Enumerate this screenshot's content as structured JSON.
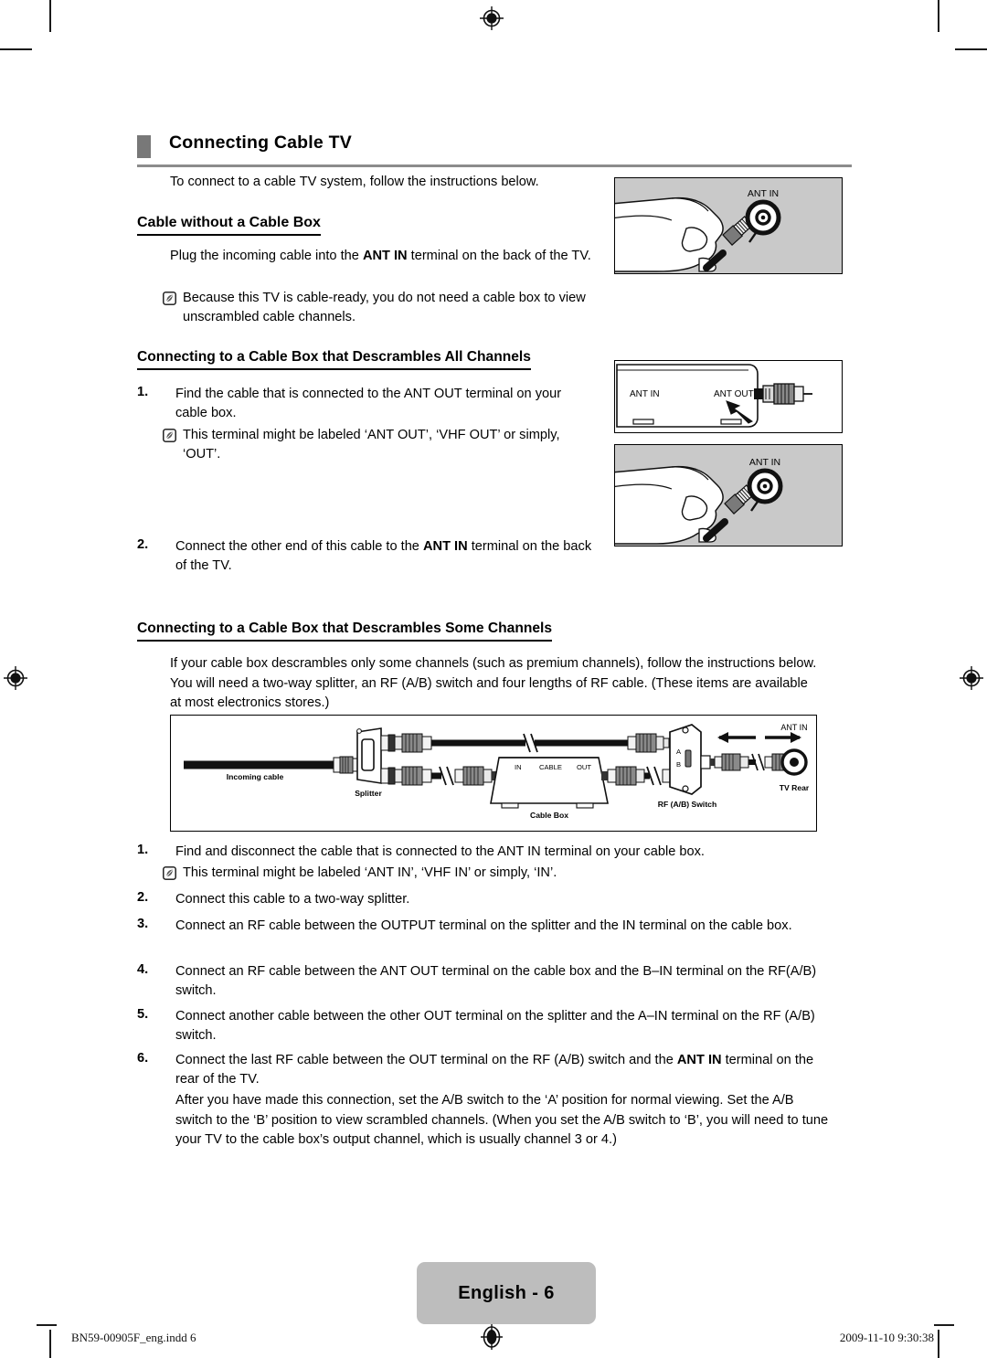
{
  "document": {
    "section_title": "Connecting Cable TV",
    "intro": "To connect to a cable TV system, follow the instructions below."
  },
  "subsections": {
    "no_box": {
      "heading": "Cable without a Cable Box",
      "body": "Plug the incoming cable into the ANT IN terminal on the back of the TV.",
      "body_pre": "Plug the incoming cable into the ",
      "body_bold": "ANT IN",
      "body_post": " terminal on the back of the TV.",
      "note": "Because this TV is cable-ready, you do not need a cable box to view unscrambled cable channels."
    },
    "all_channels": {
      "heading": "Connecting to a Cable Box that Descrambles All Channels",
      "steps": [
        {
          "num": "1.",
          "text": "Find the cable that is connected to the ANT OUT terminal on your cable box.",
          "note": "This terminal might be labeled ‘ANT OUT’, ‘VHF OUT’ or simply, ‘OUT’."
        },
        {
          "num": "2.",
          "pre": "Connect the other end of this cable to the ",
          "bold": "ANT IN",
          "post": " terminal on the back of the TV."
        }
      ]
    },
    "some_channels": {
      "heading": "Connecting to a Cable Box that Descrambles Some Channels",
      "intro": "If your cable box descrambles only some channels (such as premium channels), follow the instructions below. You will need a two-way splitter, an RF (A/B) switch and four lengths of RF cable. (These items are available at most electronics stores.)",
      "steps": [
        {
          "num": "1.",
          "text": "Find and disconnect the cable that is connected to the ANT IN terminal on your cable box.",
          "note": "This terminal might be labeled ‘ANT IN’, ‘VHF IN’ or simply, ‘IN’."
        },
        {
          "num": "2.",
          "text": "Connect this cable to a two-way splitter."
        },
        {
          "num": "3.",
          "text": "Connect an RF cable between the OUTPUT terminal on the splitter and the IN terminal on  the cable box."
        },
        {
          "num": "4.",
          "text": "Connect an RF cable between the ANT OUT terminal on the cable box and the B–IN terminal on the RF(A/B) switch."
        },
        {
          "num": "5.",
          "text": "Connect another cable between the other OUT terminal on the splitter and the A–IN terminal on the RF (A/B) switch."
        },
        {
          "num": "6.",
          "pre": "Connect the last RF cable between the OUT terminal on the RF (A/B) switch and the ",
          "bold": "ANT IN",
          "post": " terminal on the rear of the TV."
        }
      ],
      "closing": "After you have made this connection, set the A/B switch to the ‘A’ position for normal viewing. Set the A/B switch to the ‘B’ position to view scrambled channels. (When you set the A/B switch to ‘B’, you will need to tune your TV to the cable box’s output channel, which is usually channel 3 or 4.)"
    }
  },
  "illustrations": {
    "hand_top": {
      "label": "ANT IN"
    },
    "cable_box": {
      "label_in": "ANT IN",
      "label_out": "ANT OUT"
    },
    "hand_bottom": {
      "label": "ANT IN"
    },
    "wiring": {
      "incoming_cable": "Incoming cable",
      "splitter": "Splitter",
      "cable_box": "Cable Box",
      "cable_box_in": "IN",
      "cable_box_center": "CABLE",
      "cable_box_out": "OUT",
      "rf_switch": "RF (A/B) Switch",
      "rf_switch_a": "A",
      "rf_switch_b": "B",
      "ant_in": "ANT IN",
      "tv_rear": "TV Rear"
    }
  },
  "footer": {
    "page_label": "English - 6",
    "file_slug": "BN59-00905F_eng.indd   6",
    "timestamp": "2009-11-10   9:30:38"
  },
  "colors": {
    "heading_block": "#787878",
    "heading_rule": "#8c8c8c",
    "illustration_bg": "#c9c9c9",
    "badge_bg": "#bdbdbd"
  }
}
